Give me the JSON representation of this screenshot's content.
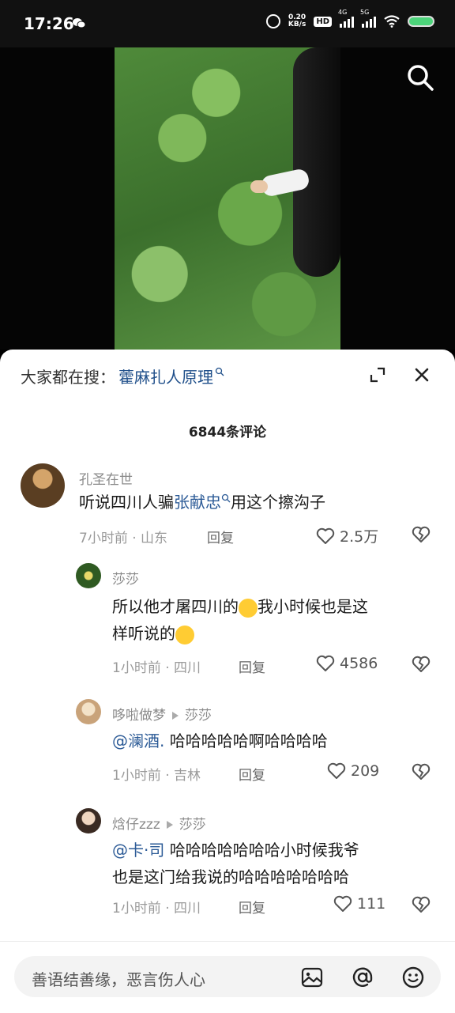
{
  "status_bar": {
    "time": "17:26",
    "net_speed_top": "0.20",
    "net_speed_bottom": "KB/s",
    "hd_label": "HD",
    "sim1_label": "4G",
    "sim2_label": "5G"
  },
  "comments_panel": {
    "hot_search_label": "大家都在搜：",
    "hot_search_term": "藿麻扎人原理",
    "comment_count": "6844条评论"
  },
  "comments": [
    {
      "username": "孔圣在世",
      "text_before": "听说四川人骗",
      "link_text": "张献忠",
      "text_after": "用这个擦沟子",
      "meta": "7小时前 · 山东",
      "reply_label": "回复",
      "likes": "2.5万"
    },
    {
      "username": "莎莎",
      "text_line1_before": "所以他才屠四川的",
      "text_line1_after": "我小时候也是这",
      "text_line2": "样听说的",
      "meta": "1小时前 · 四川",
      "reply_label": "回复",
      "likes": "4586"
    },
    {
      "username": "哆啦做梦",
      "reply_to": "莎莎",
      "mention": "@澜酒.",
      "text": " 哈哈哈哈哈啊哈哈哈哈",
      "meta": "1小时前 · 吉林",
      "reply_label": "回复",
      "likes": "209"
    },
    {
      "username": "焓仔zzz",
      "reply_to": "莎莎",
      "mention": "@卡·司",
      "text_line1": " 哈哈哈哈哈哈哈小时候我爷",
      "text_line2": "也是这门给我说的哈哈哈哈哈哈哈",
      "meta": "1小时前 · 四川",
      "reply_label": "回复",
      "likes": "111"
    }
  ],
  "input_bar": {
    "placeholder": "善语结善缘，恶言伤人心"
  },
  "colors": {
    "link": "#2b5a96",
    "hot_term": "#1f4f8a",
    "sheet_bg": "#ffffff",
    "battery": "#4cd47a"
  },
  "icons": [
    "wechat-icon",
    "alarm-icon",
    "wifi-icon",
    "battery-icon",
    "search-icon",
    "expand-icon",
    "close-icon",
    "heart-icon",
    "broken-heart-icon",
    "image-icon",
    "at-icon",
    "emoji-icon"
  ]
}
